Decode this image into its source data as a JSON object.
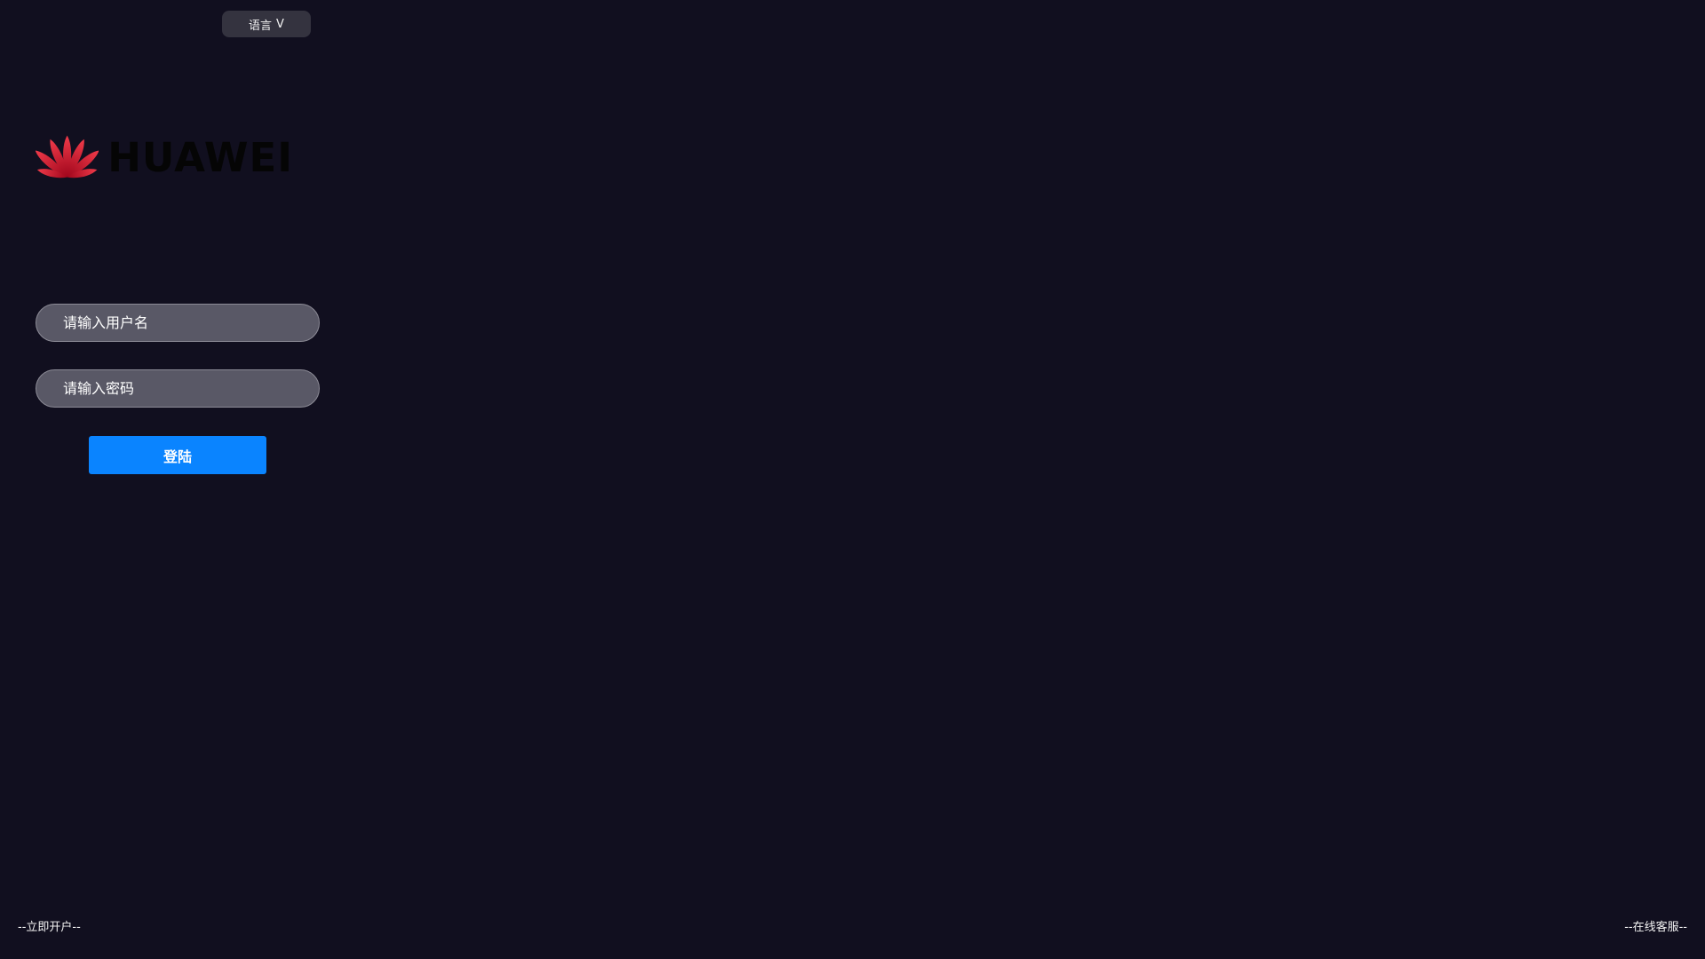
{
  "header": {
    "language_label": "语言",
    "language_caret": "V"
  },
  "logo": {
    "brand_text": "HUAWEI",
    "icon": "huawei-flower-logo",
    "brand_color": "#cf0a2c"
  },
  "login_form": {
    "username": {
      "placeholder": "请输入用户名",
      "value": ""
    },
    "password": {
      "placeholder": "请输入密码",
      "value": ""
    },
    "submit_label": "登陆"
  },
  "footer": {
    "open_account_label": "--立即开户--",
    "customer_service_label": "--在线客服--"
  },
  "colors": {
    "background": "#110f1f",
    "input_background": "#595866",
    "accent": "#0a84ff"
  }
}
